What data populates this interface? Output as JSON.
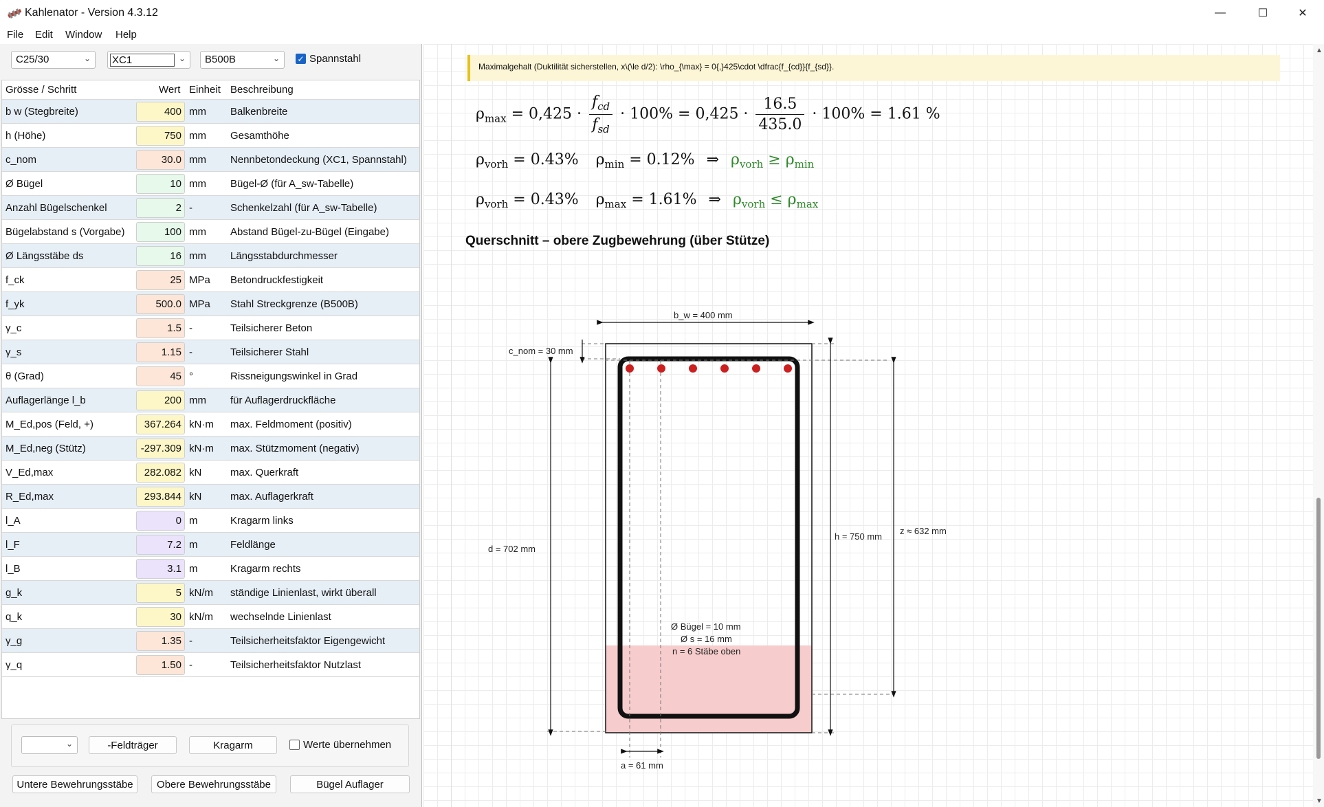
{
  "window": {
    "title": "Kahlenator - Version 4.3.12",
    "minimize": "—",
    "maximize": "☐",
    "close": "✕"
  },
  "menu": [
    "File",
    "Edit",
    "Window",
    "Help"
  ],
  "toolbar": {
    "concrete": "C25/30",
    "exposure": "XC1",
    "steel": "B500B",
    "spannstahl_label": "Spannstahl",
    "spannstahl_checked": true
  },
  "table": {
    "headers": [
      "Grösse / Schritt",
      "Wert",
      "Einheit",
      "Beschreibung"
    ],
    "rows": [
      {
        "name": "b w (Stegbreite)",
        "value": "400",
        "unit": "mm",
        "desc": "Balkenbreite",
        "color": "yellow"
      },
      {
        "name": "h (Höhe)",
        "value": "750",
        "unit": "mm",
        "desc": "Gesamthöhe",
        "color": "yellow"
      },
      {
        "name": "c_nom",
        "value": "30.0",
        "unit": "mm",
        "desc": "Nennbetondeckung (XC1, Spannstahl)",
        "color": "orange"
      },
      {
        "name": "Ø Bügel",
        "value": "10",
        "unit": "mm",
        "desc": "Bügel-Ø (für A_sw-Tabelle)",
        "color": "green"
      },
      {
        "name": "Anzahl Bügelschenkel",
        "value": "2",
        "unit": "-",
        "desc": "Schenkelzahl (für A_sw-Tabelle)",
        "color": "green"
      },
      {
        "name": "Bügelabstand s (Vorgabe)",
        "value": "100",
        "unit": "mm",
        "desc": "Abstand Bügel-zu-Bügel (Eingabe)",
        "color": "green"
      },
      {
        "name": "Ø Längsstäbe ds",
        "value": "16",
        "unit": "mm",
        "desc": "Längsstabdurchmesser",
        "color": "green"
      },
      {
        "name": "f_ck",
        "value": "25",
        "unit": "MPa",
        "desc": "Betondruckfestigkeit",
        "color": "orange"
      },
      {
        "name": "f_yk",
        "value": "500.0",
        "unit": "MPa",
        "desc": "Stahl Streckgrenze (B500B)",
        "color": "orange"
      },
      {
        "name": "γ_c",
        "value": "1.5",
        "unit": "-",
        "desc": "Teilsicherer Beton",
        "color": "orange"
      },
      {
        "name": "γ_s",
        "value": "1.15",
        "unit": "-",
        "desc": "Teilsicherer Stahl",
        "color": "orange"
      },
      {
        "name": "θ (Grad)",
        "value": "45",
        "unit": "°",
        "desc": "Rissneigungswinkel in Grad",
        "color": "orange"
      },
      {
        "name": "Auflagerlänge l_b",
        "value": "200",
        "unit": "mm",
        "desc": "für Auflagerdruckfläche",
        "color": "yellow"
      },
      {
        "name": "M_Ed,pos (Feld, +)",
        "value": "367.264",
        "unit": "kN·m",
        "desc": "max. Feldmoment (positiv)",
        "color": "yellow"
      },
      {
        "name": "M_Ed,neg (Stütz)",
        "value": "-297.309",
        "unit": "kN·m",
        "desc": "max. Stützmoment (negativ)",
        "color": "yellow"
      },
      {
        "name": "V_Ed,max",
        "value": "282.082",
        "unit": "kN",
        "desc": "max. Querkraft",
        "color": "yellow"
      },
      {
        "name": "R_Ed,max",
        "value": "293.844",
        "unit": "kN",
        "desc": "max. Auflagerkraft",
        "color": "yellow"
      },
      {
        "name": "l_A",
        "value": "0",
        "unit": "m",
        "desc": "Kragarm links",
        "color": "purple"
      },
      {
        "name": "l_F",
        "value": "7.2",
        "unit": "m",
        "desc": "Feldlänge",
        "color": "purple"
      },
      {
        "name": "l_B",
        "value": "3.1",
        "unit": "m",
        "desc": "Kragarm rechts",
        "color": "purple"
      },
      {
        "name": "g_k",
        "value": "5",
        "unit": "kN/m",
        "desc": "ständige Linienlast, wirkt überall",
        "color": "yellow"
      },
      {
        "name": "q_k",
        "value": "30",
        "unit": "kN/m",
        "desc": "wechselnde Linienlast",
        "color": "yellow"
      },
      {
        "name": "γ_g",
        "value": "1.35",
        "unit": "-",
        "desc": "Teilsicherheitsfaktor Eigengewicht",
        "color": "orange"
      },
      {
        "name": "γ_q",
        "value": "1.50",
        "unit": "-",
        "desc": "Teilsicherheitsfaktor Nutzlast",
        "color": "orange"
      }
    ]
  },
  "bottom": {
    "dropdown_value": "",
    "btn_feldtraeger": "-Feldträger",
    "btn_kragarm": "Kragarm",
    "werte_label": "Werte übernehmen",
    "btn_untere": "Untere Bewehrungsstäbe",
    "btn_obere": "Obere Bewehrungsstäbe",
    "btn_buegel": "Bügel Auflager"
  },
  "right": {
    "note": "Maximalgehalt (Duktilität sicherstellen, x\\(\\le d/2): \\rho_{\\max} = 0{,}425\\cdot \\dfrac{f_{cd}}{f_{sd}}.",
    "f1": {
      "lhs": "ρ",
      "lhs_sub": "max",
      "c1": "= 0,425 ·",
      "num": "f",
      "num_sub": "cd",
      "den": "f",
      "den_sub": "sd",
      "mid": "· 100% = 0,425 ·",
      "num2": "16.5",
      "den2": "435.0",
      "end": "· 100% = 1.61 %"
    },
    "f2": {
      "a": "ρ",
      "a_sub": "vorh",
      "a_val": "= 0.43%",
      "b": "ρ",
      "b_sub": "min",
      "b_val": "= 0.12%",
      "arrow": "⇒",
      "c": "ρ",
      "c_sub": "vorh",
      "op": "≥",
      "d": "ρ",
      "d_sub": "min"
    },
    "f3": {
      "a": "ρ",
      "a_sub": "vorh",
      "a_val": "= 0.43%",
      "b": "ρ",
      "b_sub": "max",
      "b_val": "= 1.61%",
      "arrow": "⇒",
      "c": "ρ",
      "c_sub": "vorh",
      "op": "≤",
      "d": "ρ",
      "d_sub": "max"
    },
    "section_title": "Querschnitt – obere Zugbewehrung (über Stütze)",
    "diagram": {
      "bw": "b_w = 400 mm",
      "cnom": "c_nom = 30 mm",
      "d": "d = 702 mm",
      "h": "h = 750 mm",
      "z": "z ≈ 632 mm",
      "buegel": "Ø Bügel = 10 mm",
      "ds": "Ø s = 16 mm",
      "n": "n = 6 Stäbe oben",
      "a": "a = 61 mm",
      "bar_count": 6,
      "bar_color": "#cc1f1f",
      "zone_color": "#f6cccc"
    }
  },
  "colors": {
    "accent": "#1a63c6",
    "note_border": "#e8c21a",
    "row_alt": "#e6eef6",
    "green_text": "#2e8a2a"
  }
}
